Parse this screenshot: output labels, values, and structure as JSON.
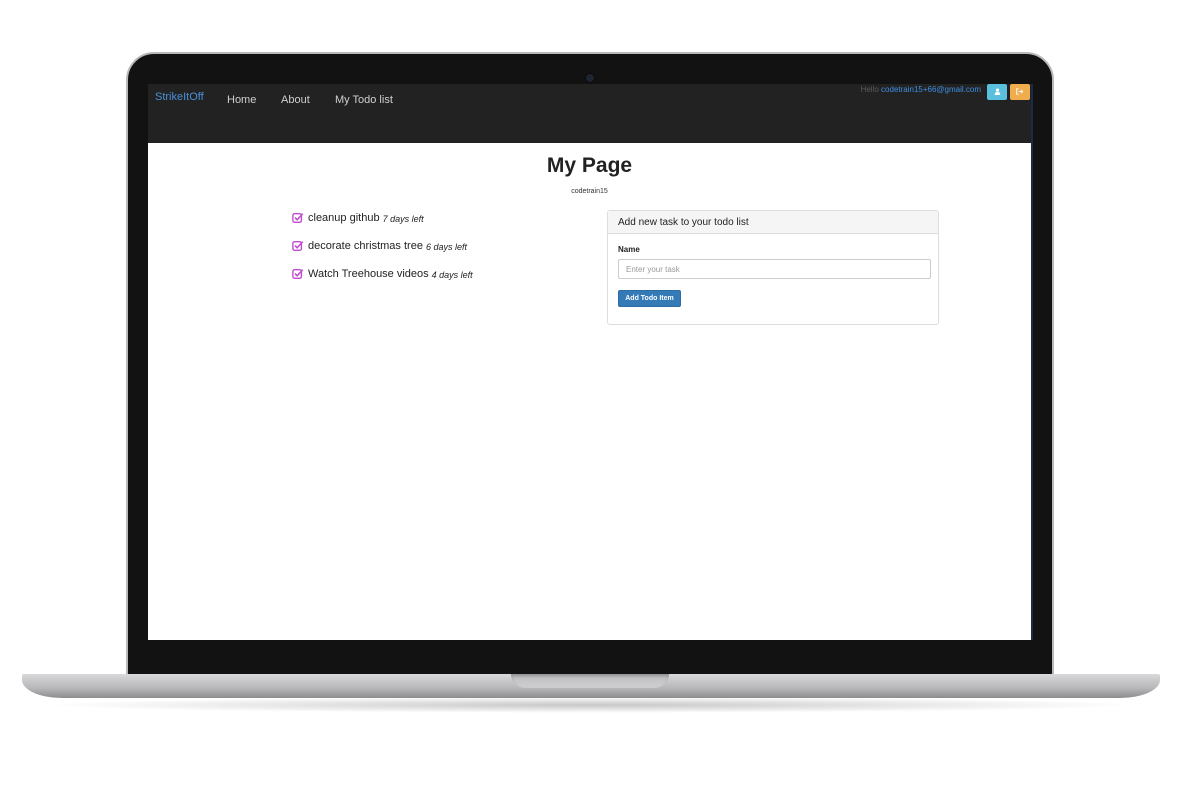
{
  "navbar": {
    "brand": "StrikeItOff",
    "links": [
      "Home",
      "About",
      "My Todo list"
    ],
    "hello_text": "Hello",
    "user_email": "codetrain15+66@gmail.com",
    "user_button_icon": "user-icon",
    "logout_button_icon": "sign-out-icon"
  },
  "page": {
    "title": "My Page",
    "username": "codetrain15"
  },
  "todos": [
    {
      "task": "cleanup github",
      "days_left": "7 days left"
    },
    {
      "task": "decorate christmas tree",
      "days_left": "6 days left"
    },
    {
      "task": "Watch Treehouse videos",
      "days_left": "4 days left"
    }
  ],
  "form": {
    "heading": "Add new task to your todo list",
    "name_label": "Name",
    "input_value": "",
    "input_placeholder": "Enter your task",
    "submit_label": "Add Todo Item"
  },
  "colors": {
    "brand": "#4a90d9",
    "check": "#c04bd0",
    "primary_button": "#337ab7",
    "info_button": "#5bc0de",
    "warning_button": "#f0ad4e",
    "navbar_bg": "#222222"
  }
}
